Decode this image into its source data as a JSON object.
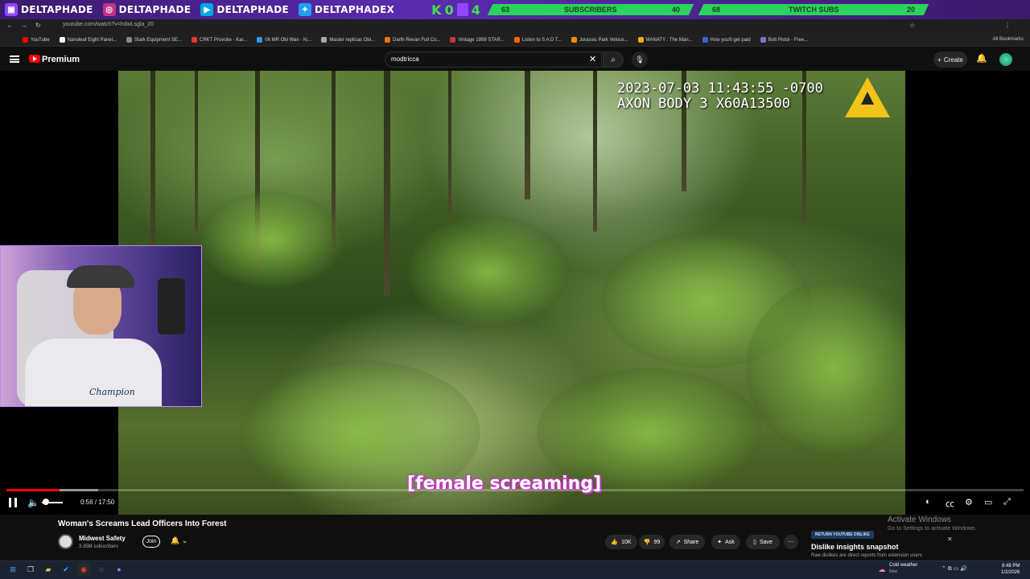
{
  "overlay": {
    "socials": [
      "DELTAPHADE",
      "DELTAPHADE",
      "DELTAPHADE",
      "DELTAPHADEX"
    ],
    "k_label": "K",
    "zero_label": "0",
    "four_label": "4",
    "subs_goal": {
      "current": "63",
      "label": "SUBSCRIBERS",
      "target": "40"
    },
    "twitch_goal": {
      "current": "68",
      "label": "TWITCH SUBS",
      "target": "20"
    }
  },
  "browser": {
    "url": "youtube.com/watch?v=hdwLsgla_20",
    "bookmarks": [
      "YouTube",
      "Nanoleaf Eight Panel...",
      "Stark Equipment SE...",
      "CRKT Provoke - Kar...",
      "06 MR Obi Wan - Ki...",
      "Master replicas Obi...",
      "Darth Revan Full Co...",
      "Vintage 1999 STAR...",
      "Listen to S A D T...",
      "Jurassic Park Veloce...",
      "MANATY : The Man...",
      "How you'll get paid",
      "Bolt Pistol - Free..."
    ],
    "all_bookmarks": "All Bookmarks"
  },
  "youtube": {
    "brand": "Premium",
    "search_value": "modtricca",
    "create_label": "Create"
  },
  "video": {
    "timestamp_line1": "2023-07-03 11:43:55 -0700",
    "timestamp_line2": "AXON BODY 3 X60A13500",
    "subtitle": "[female screaming]",
    "time": "0:56 / 17:50",
    "progress_fraction": 0.052,
    "buffer_fraction": 0.09,
    "title": "Woman's Screams Lead Officers Into Forest",
    "channel": "Midwest Safety",
    "subscribers": "3.35M subscribers",
    "join_label": "Join",
    "likes": "10K",
    "dislikes": "99",
    "share_label": "Share",
    "ask_label": "Ask",
    "save_label": "Save"
  },
  "windows": {
    "activate_title": "Activate Windows",
    "activate_sub": "Go to Settings to activate Windows."
  },
  "ryd": {
    "badge": "RETURN YOUTUBE DISLIKE",
    "title": "Dislike insights snapshot",
    "subtitle": "Raw dislikes are direct reports from extension users"
  },
  "taskbar": {
    "weather": "Cold weather",
    "weather_sub": "Now",
    "time": "8:48 PM",
    "date": "1/2/2026"
  },
  "colors": {
    "accent": "#ff0000",
    "overlay_purple": "#5a2bb0",
    "goal_green": "#2ad35c"
  }
}
